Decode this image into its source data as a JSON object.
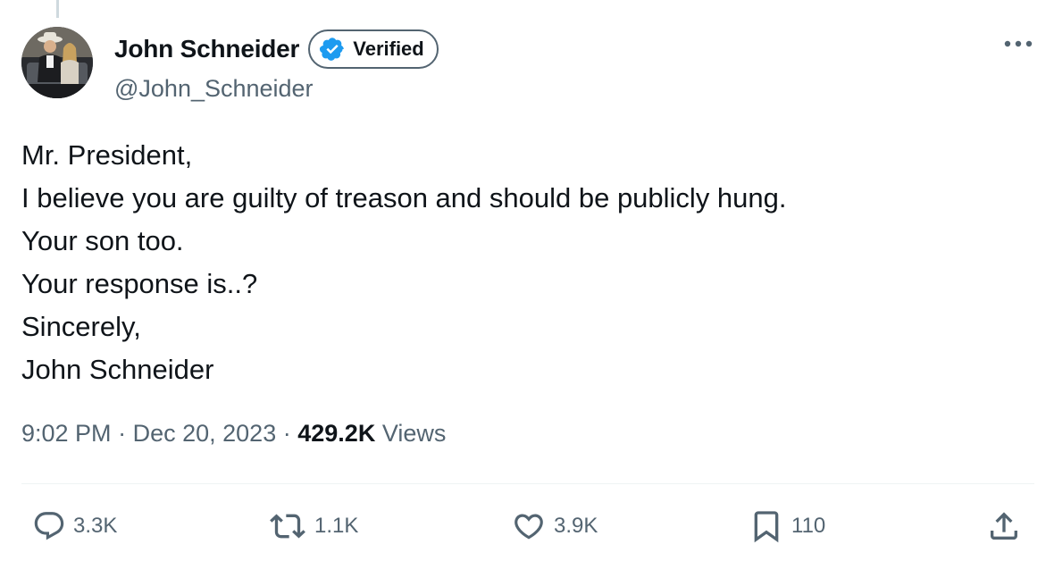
{
  "author": {
    "display_name": "John Schneider",
    "handle": "@John_Schneider",
    "verified_label": "Verified",
    "avatar_icon": "profile-photo"
  },
  "tweet": {
    "lines": [
      "Mr. President,",
      "I believe you are guilty of treason and should be publicly hung.",
      "Your son too.",
      "Your response is..?",
      "Sincerely,",
      "John Schneider"
    ]
  },
  "meta": {
    "time": "9:02 PM",
    "separator": "·",
    "date": "Dec 20, 2023",
    "views_count": "429.2K",
    "views_label": "Views"
  },
  "actions": {
    "replies": "3.3K",
    "reposts": "1.1K",
    "likes": "3.9K",
    "bookmarks": "110"
  },
  "icons": {
    "more": "more-dots-icon",
    "reply": "reply-icon",
    "repost": "repost-icon",
    "like": "heart-icon",
    "bookmark": "bookmark-icon",
    "share": "share-icon",
    "verified": "verified-badge-icon"
  },
  "colors": {
    "text": "#0f1419",
    "secondary": "#536471",
    "verified_blue": "#1d9bf0",
    "divider": "#eff3f4"
  }
}
